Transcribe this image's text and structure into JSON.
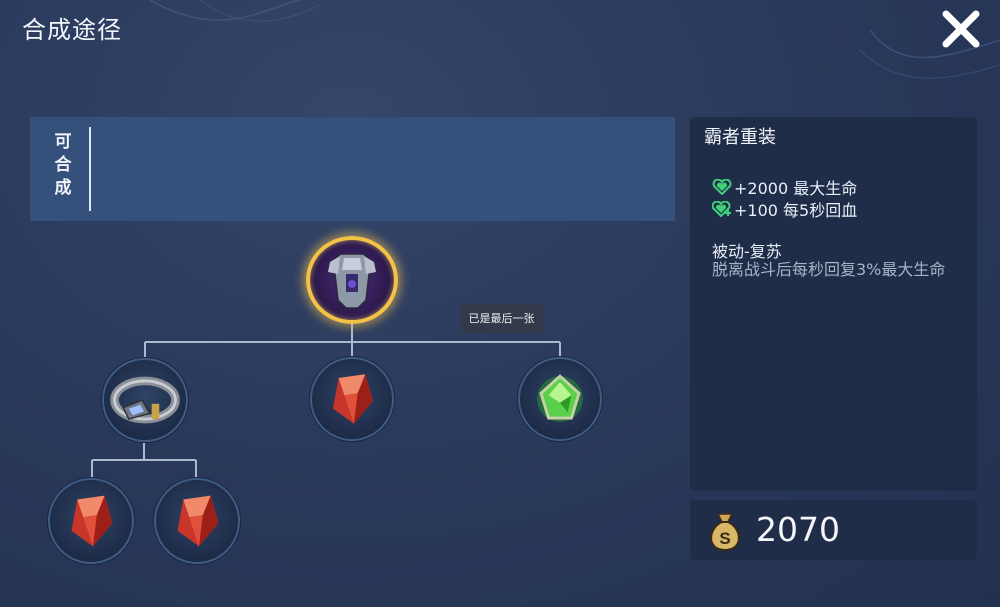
{
  "header": {
    "title": "合成途径"
  },
  "craftable": {
    "label_chars": [
      "可",
      "合",
      "成"
    ]
  },
  "tooltip": {
    "text": "已是最后一张"
  },
  "item": {
    "name": "霸者重装",
    "stats": [
      {
        "icon": "heart-icon",
        "text": "+2000 最大生命"
      },
      {
        "icon": "heart-plus-icon",
        "text": "+100 每5秒回血"
      }
    ],
    "passive": {
      "title": "被动-复苏",
      "description": "脱离战斗后每秒回复3%最大生命"
    },
    "price": "2070"
  },
  "tree_nodes": [
    {
      "name": "item-overlord-armor",
      "icon": "armor-icon"
    },
    {
      "name": "item-belt",
      "icon": "belt-icon"
    },
    {
      "name": "item-red-crystal",
      "icon": "red-crystal-icon"
    },
    {
      "name": "item-green-crystal",
      "icon": "green-crystal-icon"
    },
    {
      "name": "item-red-crystal-2",
      "icon": "red-crystal-icon"
    },
    {
      "name": "item-red-crystal-3",
      "icon": "red-crystal-icon"
    }
  ],
  "colors": {
    "background": "#2a3a5c",
    "panel": "#1f2d48",
    "highlight_ring": "#f2c246",
    "heal_green": "#3fd07a",
    "secondary_text": "#a8b3c6"
  }
}
